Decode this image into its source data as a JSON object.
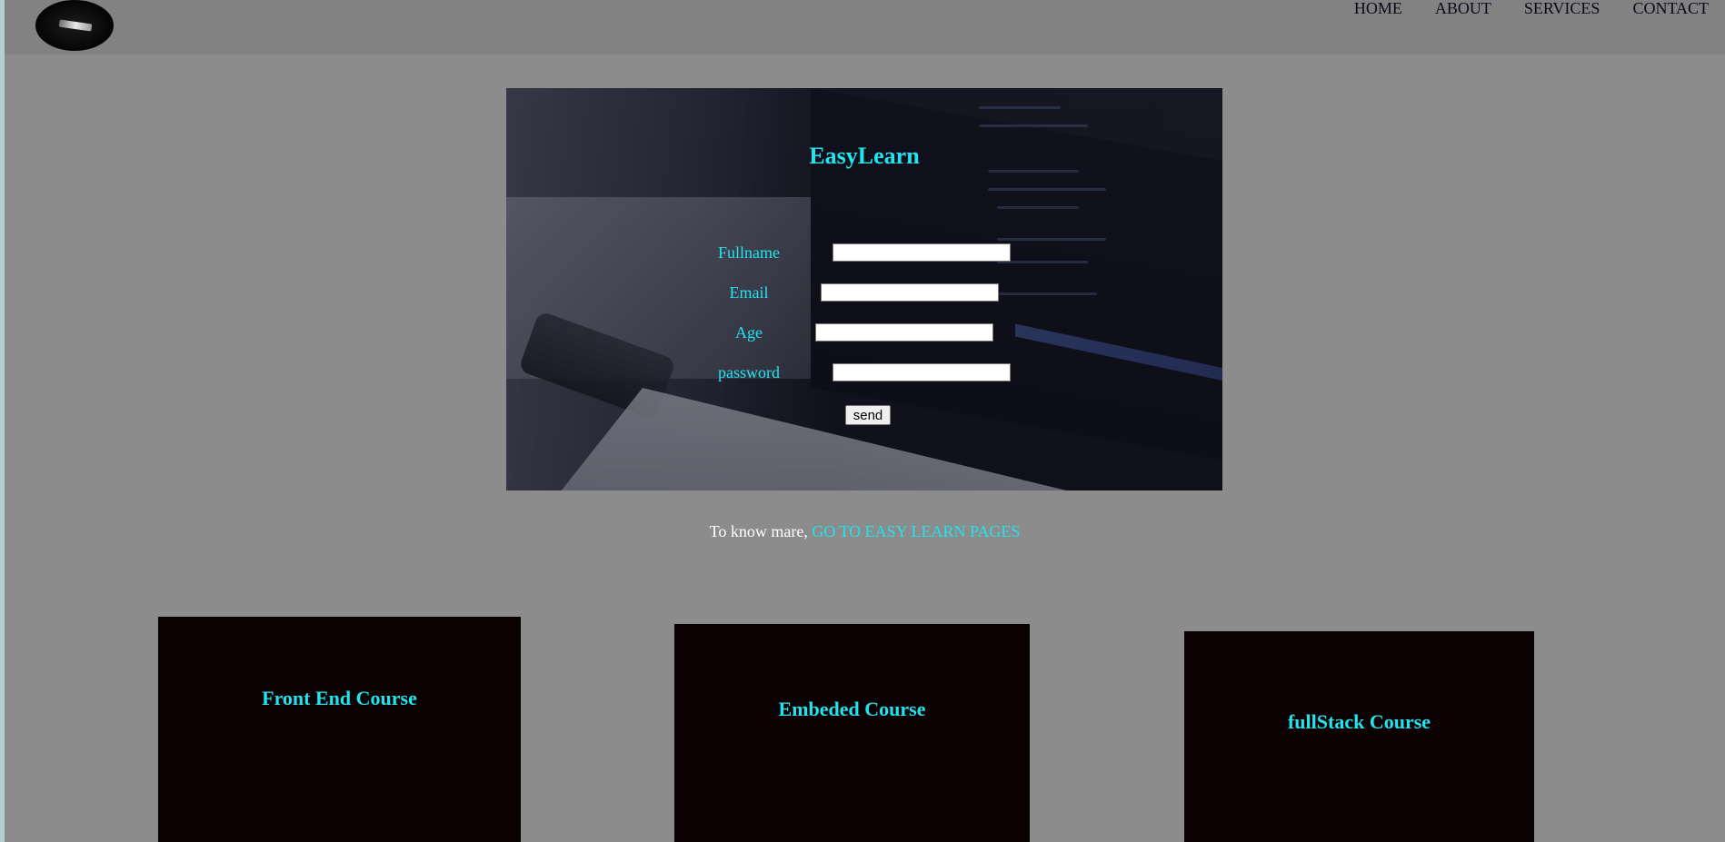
{
  "header": {
    "nav": [
      "HOME",
      "ABOUT",
      "SERVICES",
      "CONTACT"
    ]
  },
  "hero": {
    "title": "EasyLearn",
    "fields": [
      {
        "label": "Fullname",
        "value": "",
        "placeholder": ""
      },
      {
        "label": "Email",
        "value": "",
        "placeholder": ""
      },
      {
        "label": "Age",
        "value": "",
        "placeholder": ""
      },
      {
        "label": "password",
        "value": "",
        "placeholder": ""
      }
    ],
    "send_label": "send"
  },
  "know_more": {
    "prefix": "To know mare,",
    "link": "GO TO EASY LEARN PAGES"
  },
  "courses": [
    {
      "title": "Front End Course"
    },
    {
      "title": "Embeded Course"
    },
    {
      "title": "fullStack Course"
    }
  ],
  "colors": {
    "accent": "#22e4ee",
    "page_bg": "#8c8c8c",
    "header_bg": "#828282",
    "card_bg": "#0b0102"
  },
  "icons": {
    "logo": "phone-logo-icon"
  }
}
